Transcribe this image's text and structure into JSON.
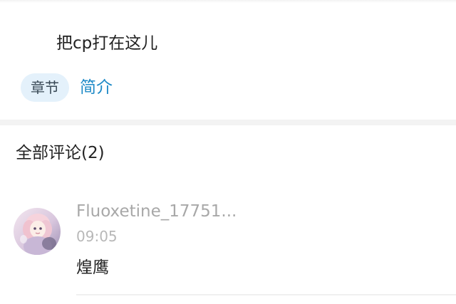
{
  "post": {
    "text": "把cp打在这儿"
  },
  "tags": {
    "chapter_label": "章节",
    "intro_label": "简介"
  },
  "comments_section": {
    "header": "全部评论(2)",
    "items": [
      {
        "username": "Fluoxetine_17751...",
        "time": "09:05",
        "text": "煌鹰",
        "avatar_icon": "anime-girl-avatar"
      }
    ]
  },
  "colors": {
    "accent_link": "#1e8ac7",
    "chip_background": "#e4f1fb",
    "muted_text": "#a8a8a8",
    "body_text": "#222222"
  }
}
